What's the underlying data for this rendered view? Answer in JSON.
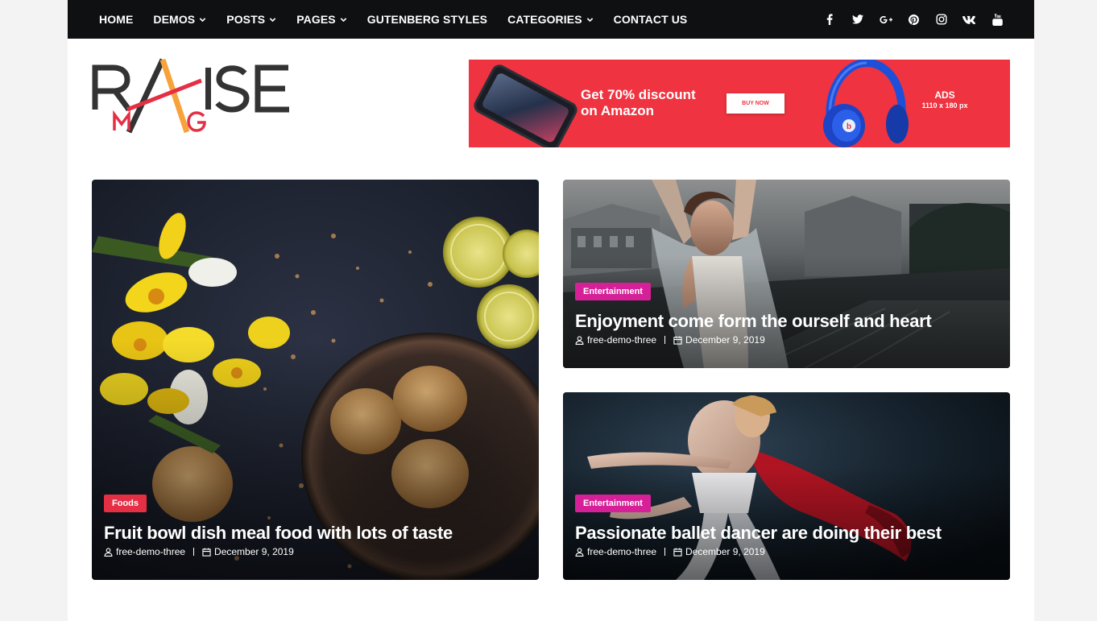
{
  "nav": {
    "items": [
      {
        "label": "HOME",
        "dropdown": false
      },
      {
        "label": "DEMOS",
        "dropdown": true
      },
      {
        "label": "POSTS",
        "dropdown": true
      },
      {
        "label": "PAGES",
        "dropdown": true
      },
      {
        "label": "GUTENBERG STYLES",
        "dropdown": false
      },
      {
        "label": "CATEGORIES",
        "dropdown": true
      },
      {
        "label": "CONTACT US",
        "dropdown": false
      }
    ],
    "social": [
      "facebook-icon",
      "twitter-icon",
      "google-plus-icon",
      "pinterest-icon",
      "instagram-icon",
      "vk-icon",
      "youtube-icon"
    ]
  },
  "logo": {
    "text_main": "R ISE",
    "text_sub": "M G",
    "colors": {
      "dark": "#333333",
      "red": "#e42f44",
      "orange": "#f7a23b"
    }
  },
  "ad": {
    "headline_line1": "Get 70% discount",
    "headline_line2": "on Amazon",
    "button_label": "BUY NOW",
    "size_label": "ADS",
    "size_dims": "1110 x 180 px",
    "background": "#ef3340"
  },
  "posts": [
    {
      "category": "Foods",
      "title": "Fruit bowl dish meal food with lots of taste",
      "author": "free-demo-three",
      "date": "December 9, 2019"
    },
    {
      "category": "Entertainment",
      "title": "Enjoyment come form the ourself and heart",
      "author": "free-demo-three",
      "date": "December 9, 2019"
    },
    {
      "category": "Entertainment",
      "title": "Passionate ballet dancer are doing their best",
      "author": "free-demo-three",
      "date": "December 9, 2019"
    }
  ],
  "colors": {
    "topbar": "#0f1012",
    "foods_badge": "#e42f44",
    "entertainment_badge": "#d62097"
  }
}
